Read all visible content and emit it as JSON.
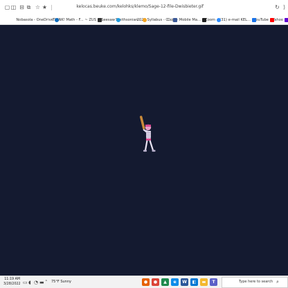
{
  "browser": {
    "url": "kelocas.beuke.com/kelohks/klemo/Sage-12-file-Dwisbieter.gif",
    "toolbar_icons": [
      "reload-icon",
      "extensions-icon",
      "star-icon",
      "favorites-icon",
      "collections-icon",
      "split-screen-icon",
      "tab-actions-icon",
      "window-icon"
    ]
  },
  "bookmarks": [
    {
      "label": "Yahoo",
      "icon": "yahoo-icon",
      "color": "#6001d2"
    },
    {
      "label": "YouTube",
      "icon": "youtube-icon",
      "color": "#ff0000"
    },
    {
      "label": "(31) e-mail KEL...",
      "icon": "mail-icon",
      "color": "#1a73e8"
    },
    {
      "label": "Zoom",
      "icon": "zoom-icon",
      "color": "#2d8cff"
    },
    {
      "label": "Dojo - Mobile Ma...",
      "icon": "dojo-icon",
      "color": "#222222"
    },
    {
      "label": "2022 Syllabus - C...",
      "icon": "document-icon",
      "color": "#3b5998"
    },
    {
      "label": "Smithsonian...",
      "icon": "smithsonian-icon",
      "color": "#f5a623"
    },
    {
      "label": "Seesaw",
      "icon": "seesaw-icon",
      "color": "#1f9bde"
    },
    {
      "label": "THINK! Math - F... ~ ZUS",
      "icon": "math-icon",
      "color": "#333333"
    },
    {
      "label": "Nobasola - OneDrive",
      "icon": "onedrive-icon",
      "color": "#0f6cbd"
    }
  ],
  "taskbar": {
    "time": "11:19 AM",
    "date": "3/28/2022",
    "weather": "75°F Sunny",
    "search_placeholder": "Type here to search",
    "apps": [
      {
        "icon": "teams-icon",
        "color": "#5b5fc7"
      },
      {
        "icon": "explorer-icon",
        "color": "#f3b82e"
      },
      {
        "icon": "store-icon",
        "color": "#0078d4"
      },
      {
        "icon": "word-icon",
        "color": "#2b579a"
      },
      {
        "icon": "edge-icon",
        "color": "#0c8ce9"
      },
      {
        "icon": "photos-icon",
        "color": "#1d8a4d"
      },
      {
        "icon": "chrome-icon",
        "color": "#db4437"
      },
      {
        "icon": "firefox-icon",
        "color": "#e66000"
      }
    ]
  },
  "game": {
    "background_color": "#141a30",
    "character": "skeleton-batter-sprite"
  }
}
